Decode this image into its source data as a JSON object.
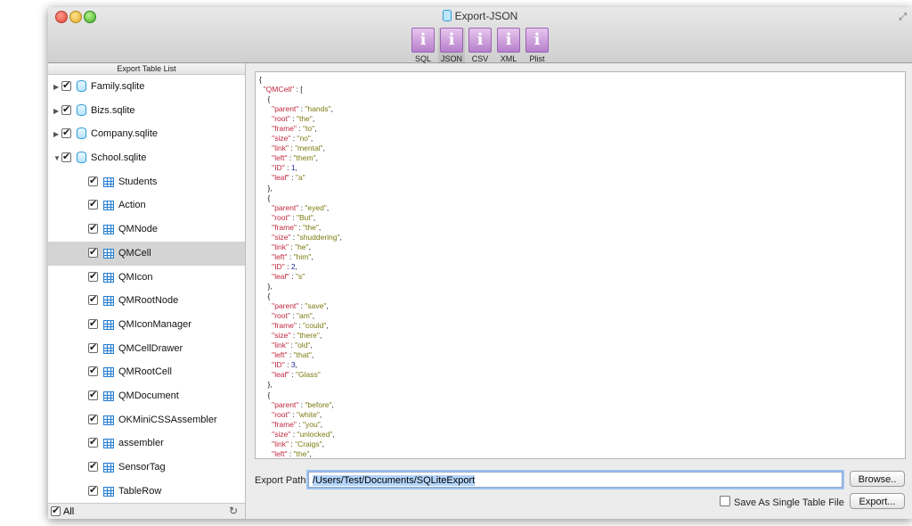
{
  "window": {
    "title": "Export-JSON"
  },
  "toolbar": [
    {
      "label": "SQL",
      "icon": "info-icon",
      "selected": false
    },
    {
      "label": "JSON",
      "icon": "info-icon",
      "selected": true
    },
    {
      "label": "CSV",
      "icon": "info-icon",
      "selected": false
    },
    {
      "label": "XML",
      "icon": "info-icon",
      "selected": false
    },
    {
      "label": "Plist",
      "icon": "info-icon",
      "selected": false
    }
  ],
  "sidebar": {
    "header": "Export Table List",
    "databases": [
      {
        "name": "Family.sqlite",
        "expanded": false,
        "checked": true
      },
      {
        "name": "Bizs.sqlite",
        "expanded": false,
        "checked": true
      },
      {
        "name": "Company.sqlite",
        "expanded": false,
        "checked": true
      },
      {
        "name": "School.sqlite",
        "expanded": true,
        "checked": true
      }
    ],
    "tables": [
      {
        "name": "Students",
        "checked": true
      },
      {
        "name": "Action",
        "checked": true
      },
      {
        "name": "QMNode",
        "checked": true
      },
      {
        "name": "QMCell",
        "checked": true,
        "selected": true
      },
      {
        "name": "QMIcon",
        "checked": true
      },
      {
        "name": "QMRootNode",
        "checked": true
      },
      {
        "name": "QMIconManager",
        "checked": true
      },
      {
        "name": "QMCellDrawer",
        "checked": true
      },
      {
        "name": "QMRootCell",
        "checked": true
      },
      {
        "name": "QMDocument",
        "checked": true
      },
      {
        "name": "OKMiniCSSAssembler",
        "checked": true
      },
      {
        "name": "assembler",
        "checked": true
      },
      {
        "name": "SensorTag",
        "checked": true
      },
      {
        "name": "TableRow",
        "checked": true
      }
    ],
    "footer": {
      "all_label": "All",
      "all_checked": true
    }
  },
  "preview": {
    "table_key": "QMCell",
    "records": [
      {
        "parent": "hands",
        "root": "the",
        "frame": "to",
        "size": "no",
        "link": "mental",
        "left": "them",
        "ID": 1,
        "leaf": "a"
      },
      {
        "parent": "eyed",
        "root": "But",
        "frame": "the",
        "size": "shuddering",
        "link": "he",
        "left": "him",
        "ID": 2,
        "leaf": "s"
      },
      {
        "parent": "save",
        "root": "am",
        "frame": "could",
        "size": "there",
        "link": "old",
        "left": "that",
        "ID": 3,
        "leaf": "Glass"
      },
      {
        "parent": "before",
        "root": "white",
        "frame": "you",
        "size": "unlocked",
        "link": "Craigs",
        "left": "the"
      }
    ]
  },
  "export": {
    "path_label": "Export Path:",
    "path_value": "/Users/Test/Documents/SQLiteExport",
    "browse_label": "Browse..",
    "single_file_label": "Save As Single Table File",
    "single_file_checked": false,
    "export_label": "Export..."
  },
  "colors": {
    "json_key": "#c0283f",
    "json_string": "#7a7a10",
    "json_number": "#1a2a9a",
    "selection": "#d4d4d4"
  }
}
